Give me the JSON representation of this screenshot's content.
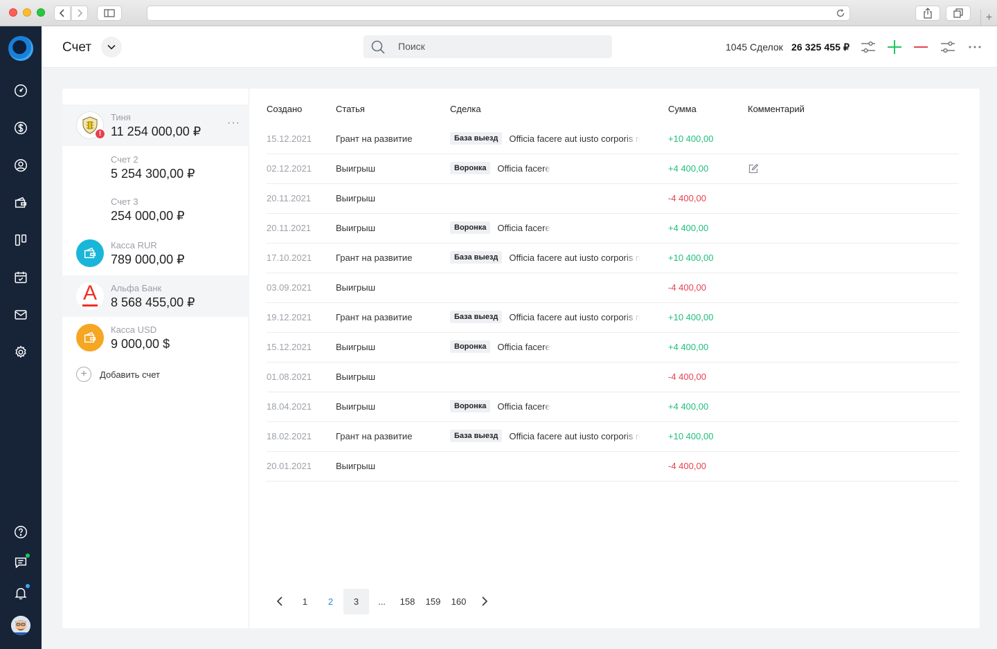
{
  "header": {
    "title": "Счет",
    "search_placeholder": "Поиск",
    "deals_count": "1045 Сделок",
    "total": "26 325 455 ₽"
  },
  "accounts": [
    {
      "name": "Тиня",
      "balance": "11 254 000,00 ₽",
      "icon": "bank-crest-icon",
      "alert": "!",
      "more": "···"
    },
    {
      "name": "Счет 2",
      "balance": "5 254 300,00 ₽"
    },
    {
      "name": "Счет 3",
      "balance": "254 000,00 ₽"
    },
    {
      "name": "Касса RUR",
      "balance": "789 000,00 ₽",
      "icon": "wallet-icon",
      "color": "#1ab6d9"
    },
    {
      "name": "Альфа Банк",
      "balance": "8 568 455,00 ₽",
      "icon": "alfa-logo-icon",
      "logo_letter": "A",
      "color": "#ef3124"
    },
    {
      "name": "Касса USD",
      "balance": "9 000,00 $",
      "icon": "wallet-icon",
      "color": "#f5a623"
    }
  ],
  "add_account": "Добавить счет",
  "table": {
    "columns": [
      "Создано",
      "Статья",
      "Сделка",
      "Сумма",
      "Комментарий"
    ],
    "rows": [
      {
        "date": "15.12.2021",
        "article": "Грант на развитие",
        "tag": "База выезд",
        "deal": "Officia facere aut iusto corporis n",
        "sum": "+10 400,00",
        "kind": "pos"
      },
      {
        "date": "02.12.2021",
        "article": "Выигрыш",
        "tag": "Воронка",
        "deal": "Officia facere",
        "sum": "+4 400,00",
        "kind": "pos",
        "comment_edit": true
      },
      {
        "date": "20.11.2021",
        "article": "Выигрыш",
        "tag": "",
        "deal": "",
        "sum": "-4 400,00",
        "kind": "neg"
      },
      {
        "date": "20.11.2021",
        "article": "Выигрыш",
        "tag": "Воронка",
        "deal": "Officia facere",
        "sum": "+4 400,00",
        "kind": "pos"
      },
      {
        "date": "17.10.2021",
        "article": "Грант на развитие",
        "tag": "База выезд",
        "deal": "Officia facere aut iusto corporis n",
        "sum": "+10 400,00",
        "kind": "pos"
      },
      {
        "date": "03.09.2021",
        "article": "Выигрыш",
        "tag": "",
        "deal": "",
        "sum": "-4 400,00",
        "kind": "neg"
      },
      {
        "date": "19.12.2021",
        "article": "Грант на развитие",
        "tag": "База выезд",
        "deal": "Officia facere aut iusto corporis n",
        "sum": "+10 400,00",
        "kind": "pos"
      },
      {
        "date": "15.12.2021",
        "article": "Выигрыш",
        "tag": "Воронка",
        "deal": "Officia facere",
        "sum": "+4 400,00",
        "kind": "pos"
      },
      {
        "date": "01.08.2021",
        "article": "Выигрыш",
        "tag": "",
        "deal": "",
        "sum": "-4 400,00",
        "kind": "neg"
      },
      {
        "date": "18.04.2021",
        "article": "Выигрыш",
        "tag": "Воронка",
        "deal": "Officia facere",
        "sum": "+4 400,00",
        "kind": "pos"
      },
      {
        "date": "18.02.2021",
        "article": "Грант на развитие",
        "tag": "База выезд",
        "deal": "Officia facere aut iusto corporis n",
        "sum": "+10 400,00",
        "kind": "pos"
      },
      {
        "date": "20.01.2021",
        "article": "Выигрыш",
        "tag": "",
        "deal": "",
        "sum": "-4 400,00",
        "kind": "neg"
      }
    ]
  },
  "pagination": {
    "pages": [
      "1",
      "2",
      "3",
      "...",
      "158",
      "159",
      "160"
    ],
    "current": "3",
    "highlighted": "2"
  },
  "colors": {
    "nav_bg": "#172438",
    "positive": "#1fbf7a",
    "negative": "#e8414f",
    "add": "#22c55e",
    "remove": "#e8414f"
  }
}
